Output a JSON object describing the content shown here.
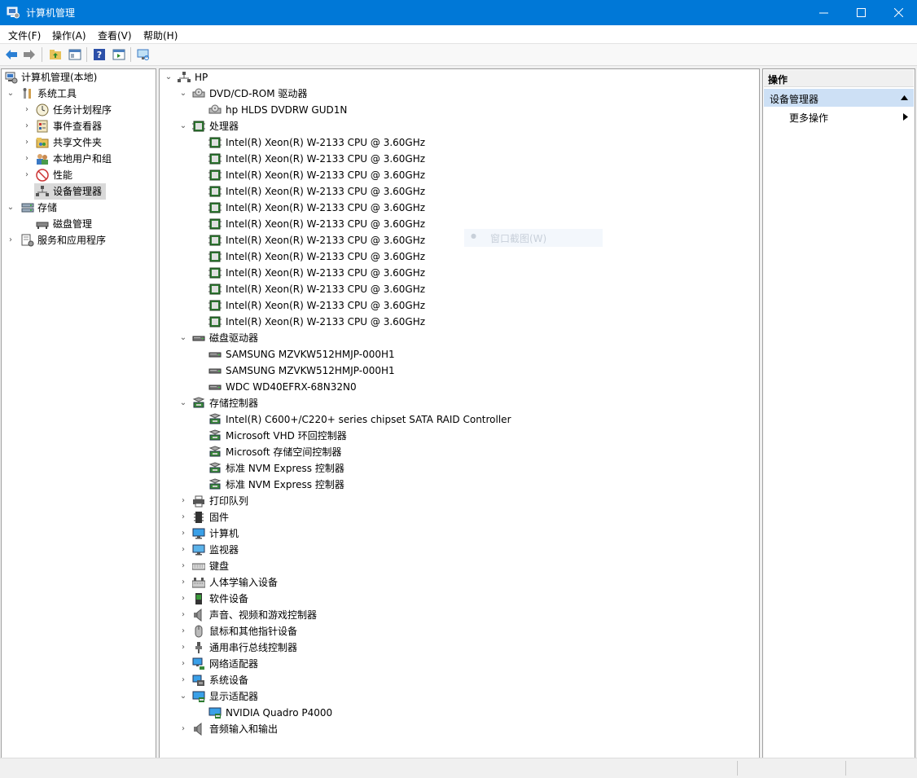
{
  "window": {
    "title": "计算机管理"
  },
  "menu": {
    "file": "文件(F)",
    "action": "操作(A)",
    "view": "查看(V)",
    "help": "帮助(H)"
  },
  "left_tree": {
    "root": "计算机管理(本地)",
    "system_tools": "系统工具",
    "task_scheduler": "任务计划程序",
    "event_viewer": "事件查看器",
    "shared_folders": "共享文件夹",
    "local_users": "本地用户和组",
    "performance": "性能",
    "device_manager": "设备管理器",
    "storage": "存储",
    "disk_management": "磁盘管理",
    "services_apps": "服务和应用程序"
  },
  "device_tree": {
    "root": "HP",
    "rows": [
      {
        "label": "DVD/CD-ROM 驱动器",
        "level": 1,
        "state": "expanded",
        "icon": "dvd-icon"
      },
      {
        "label": "hp HLDS DVDRW  GUD1N",
        "level": 2,
        "icon": "dvd-icon"
      },
      {
        "label": "处理器",
        "level": 1,
        "state": "expanded",
        "icon": "cpu-icon"
      },
      {
        "label": "Intel(R) Xeon(R) W-2133 CPU @ 3.60GHz",
        "level": 2,
        "icon": "cpu-icon"
      },
      {
        "label": "Intel(R) Xeon(R) W-2133 CPU @ 3.60GHz",
        "level": 2,
        "icon": "cpu-icon"
      },
      {
        "label": "Intel(R) Xeon(R) W-2133 CPU @ 3.60GHz",
        "level": 2,
        "icon": "cpu-icon"
      },
      {
        "label": "Intel(R) Xeon(R) W-2133 CPU @ 3.60GHz",
        "level": 2,
        "icon": "cpu-icon"
      },
      {
        "label": "Intel(R) Xeon(R) W-2133 CPU @ 3.60GHz",
        "level": 2,
        "icon": "cpu-icon"
      },
      {
        "label": "Intel(R) Xeon(R) W-2133 CPU @ 3.60GHz",
        "level": 2,
        "icon": "cpu-icon"
      },
      {
        "label": "Intel(R) Xeon(R) W-2133 CPU @ 3.60GHz",
        "level": 2,
        "icon": "cpu-icon"
      },
      {
        "label": "Intel(R) Xeon(R) W-2133 CPU @ 3.60GHz",
        "level": 2,
        "icon": "cpu-icon"
      },
      {
        "label": "Intel(R) Xeon(R) W-2133 CPU @ 3.60GHz",
        "level": 2,
        "icon": "cpu-icon"
      },
      {
        "label": "Intel(R) Xeon(R) W-2133 CPU @ 3.60GHz",
        "level": 2,
        "icon": "cpu-icon"
      },
      {
        "label": "Intel(R) Xeon(R) W-2133 CPU @ 3.60GHz",
        "level": 2,
        "icon": "cpu-icon"
      },
      {
        "label": "Intel(R) Xeon(R) W-2133 CPU @ 3.60GHz",
        "level": 2,
        "icon": "cpu-icon"
      },
      {
        "label": "磁盘驱动器",
        "level": 1,
        "state": "expanded",
        "icon": "disk-icon"
      },
      {
        "label": "SAMSUNG MZVKW512HMJP-000H1",
        "level": 2,
        "icon": "disk-icon"
      },
      {
        "label": "SAMSUNG MZVKW512HMJP-000H1",
        "level": 2,
        "icon": "disk-icon"
      },
      {
        "label": "WDC WD40EFRX-68N32N0",
        "level": 2,
        "icon": "disk-icon"
      },
      {
        "label": "存储控制器",
        "level": 1,
        "state": "expanded",
        "icon": "storage-controller-icon"
      },
      {
        "label": "Intel(R) C600+/C220+ series chipset SATA RAID Controller",
        "level": 2,
        "icon": "storage-controller-icon"
      },
      {
        "label": "Microsoft VHD 环回控制器",
        "level": 2,
        "icon": "storage-controller-icon"
      },
      {
        "label": "Microsoft 存储空间控制器",
        "level": 2,
        "icon": "storage-controller-icon"
      },
      {
        "label": "标准 NVM Express 控制器",
        "level": 2,
        "icon": "storage-controller-icon"
      },
      {
        "label": "标准 NVM Express 控制器",
        "level": 2,
        "icon": "storage-controller-icon"
      },
      {
        "label": "打印队列",
        "level": 1,
        "state": "collapsed",
        "icon": "printer-icon"
      },
      {
        "label": "固件",
        "level": 1,
        "state": "collapsed",
        "icon": "firmware-icon"
      },
      {
        "label": "计算机",
        "level": 1,
        "state": "collapsed",
        "icon": "computer-icon"
      },
      {
        "label": "监视器",
        "level": 1,
        "state": "collapsed",
        "icon": "monitor-icon"
      },
      {
        "label": "键盘",
        "level": 1,
        "state": "collapsed",
        "icon": "keyboard-icon"
      },
      {
        "label": "人体学输入设备",
        "level": 1,
        "state": "collapsed",
        "icon": "hid-icon"
      },
      {
        "label": "软件设备",
        "level": 1,
        "state": "collapsed",
        "icon": "software-device-icon"
      },
      {
        "label": "声音、视频和游戏控制器",
        "level": 1,
        "state": "collapsed",
        "icon": "speaker-icon"
      },
      {
        "label": "鼠标和其他指针设备",
        "level": 1,
        "state": "collapsed",
        "icon": "mouse-icon"
      },
      {
        "label": "通用串行总线控制器",
        "level": 1,
        "state": "collapsed",
        "icon": "usb-icon"
      },
      {
        "label": "网络适配器",
        "level": 1,
        "state": "collapsed",
        "icon": "network-icon"
      },
      {
        "label": "系统设备",
        "level": 1,
        "state": "collapsed",
        "icon": "system-device-icon"
      },
      {
        "label": "显示适配器",
        "level": 1,
        "state": "expanded",
        "icon": "display-adapter-icon"
      },
      {
        "label": "NVIDIA Quadro P4000",
        "level": 2,
        "icon": "display-adapter-icon"
      },
      {
        "label": "音频输入和输出",
        "level": 1,
        "state": "collapsed",
        "icon": "speaker-icon"
      }
    ]
  },
  "actions": {
    "header": "操作",
    "section": "设备管理器",
    "more": "更多操作"
  },
  "overlay": {
    "text": "窗口截图(W)"
  }
}
